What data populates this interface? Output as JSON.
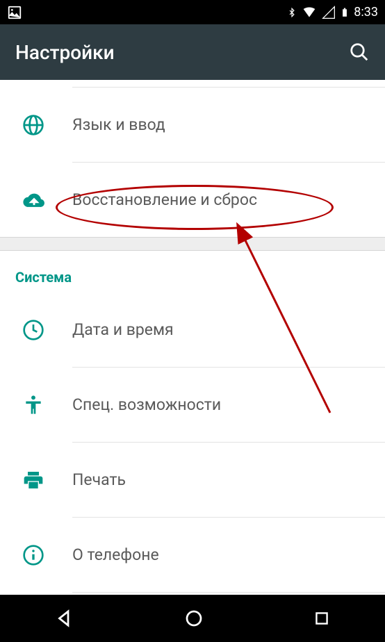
{
  "status": {
    "time": "8:33"
  },
  "appbar": {
    "title": "Настройки"
  },
  "group1": [
    {
      "icon": "globe-icon",
      "label": "Язык и ввод"
    },
    {
      "icon": "backup-icon",
      "label": "Восстановление и сброс"
    }
  ],
  "section_system_label": "Система",
  "group2": [
    {
      "icon": "clock-icon",
      "label": "Дата и время"
    },
    {
      "icon": "accessibility-icon",
      "label": "Спец. возможности"
    },
    {
      "icon": "print-icon",
      "label": "Печать"
    },
    {
      "icon": "info-icon",
      "label": "О телефоне"
    }
  ],
  "annotation": {
    "highlighted": "Восстановление и сброс"
  }
}
